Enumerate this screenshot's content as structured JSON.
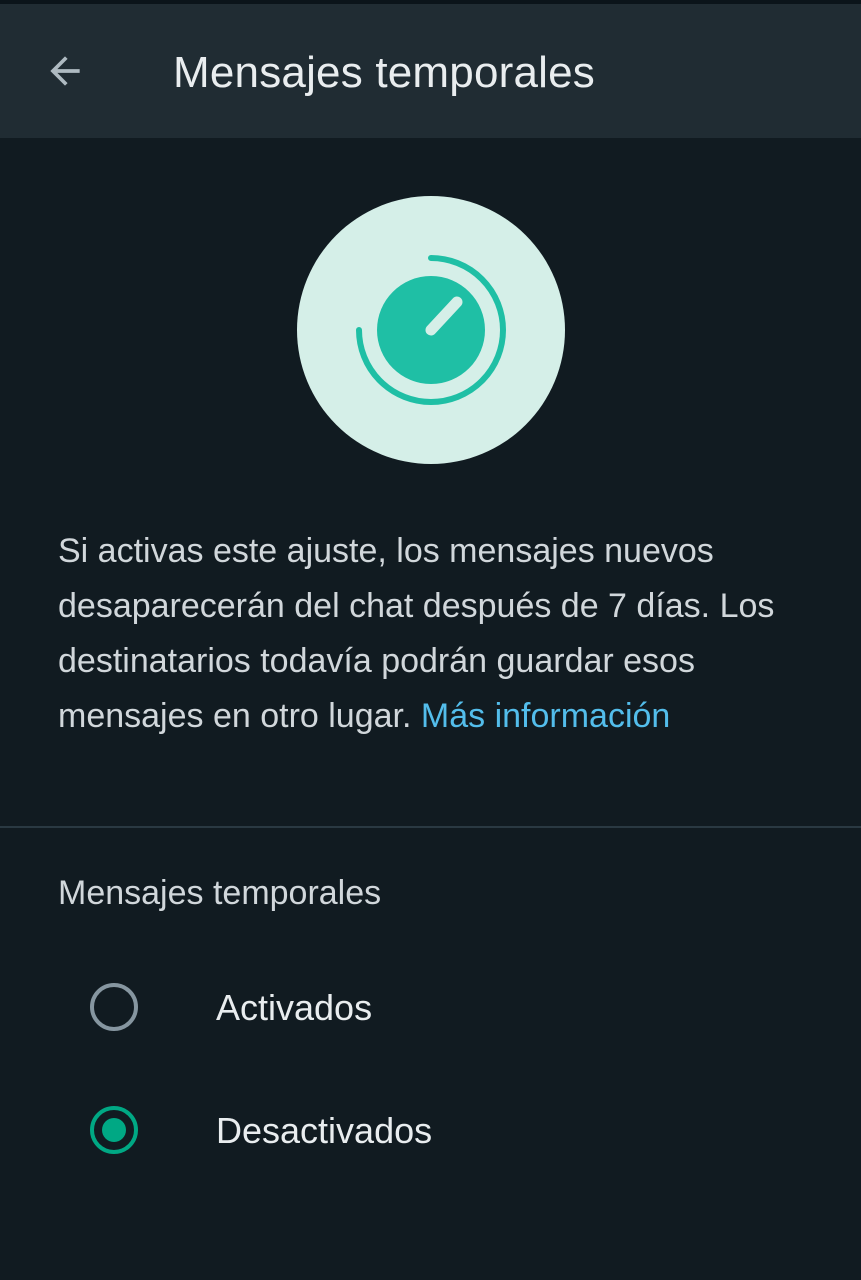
{
  "header": {
    "title": "Mensajes temporales"
  },
  "description": {
    "text": "Si activas este ajuste, los mensajes nuevos desaparecerán del chat después de 7 días. Los destinatarios todavía podrán guardar esos mensajes en otro lugar. ",
    "link_text": "Más información"
  },
  "settings": {
    "section_title": "Mensajes temporales",
    "options": [
      {
        "label": "Activados",
        "selected": false
      },
      {
        "label": "Desactivados",
        "selected": true
      }
    ]
  },
  "colors": {
    "background": "#111b21",
    "header": "#202c33",
    "accent": "#00a884",
    "link": "#53bdeb",
    "illustration_bg": "#d5efe8",
    "illustration_fg": "#1fbfa5"
  },
  "icons": {
    "back": "arrow-back-icon",
    "timer": "disappearing-timer-icon"
  }
}
